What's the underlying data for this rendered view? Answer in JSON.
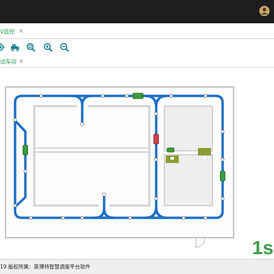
{
  "top_bar": {
    "icon": "user-avatar-icon"
  },
  "tabs": [
    {
      "label": "V监控",
      "close": "×"
    }
  ],
  "toolbar": {
    "buttons": [
      {
        "icon": "locate-icon"
      },
      {
        "icon": "vehicle-icon"
      },
      {
        "icon": "zoom-search-icon"
      },
      {
        "icon": "zoom-in-icon"
      },
      {
        "icon": "zoom-out-icon"
      }
    ]
  },
  "map_tabs": [
    {
      "label": "试车间",
      "close": "×"
    }
  ],
  "map": {
    "scale_label": "1s"
  },
  "footer": {
    "copyright": "19 版权所属：英博特智慧调度平台软件"
  },
  "colors": {
    "accent": "#1f9a56",
    "track": "#1e6fc4",
    "vehicle": "#3d9b3a",
    "vehicle_alert": "#d04040",
    "station": "#8f9c34",
    "scale_text": "#3c9a48",
    "toolbar_icon": "#17808b"
  }
}
